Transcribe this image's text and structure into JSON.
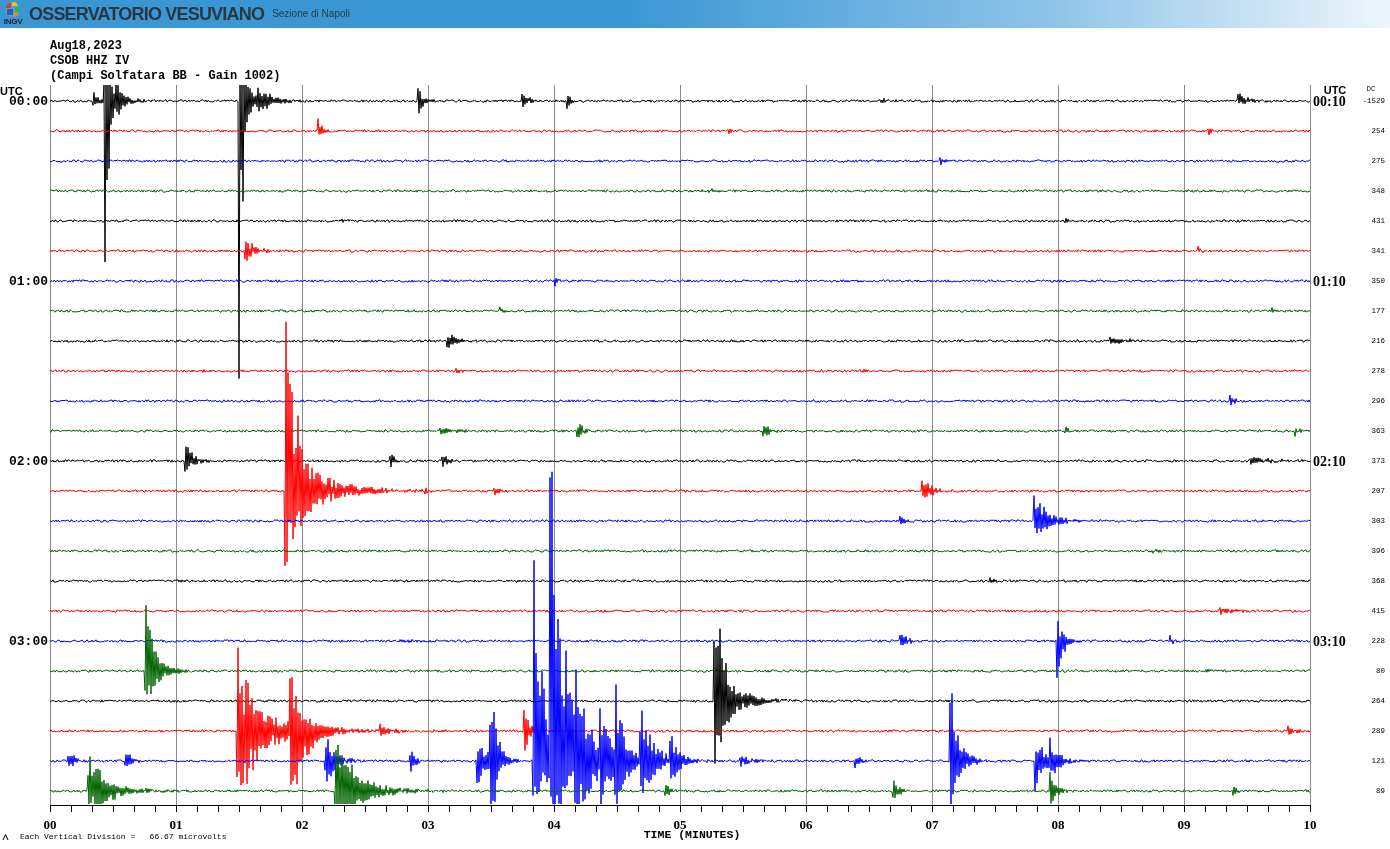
{
  "header": {
    "logo_text": "INGV",
    "title": "OSSERVATORIO VESUVIANO",
    "subtitle": "Sezione di Napoli"
  },
  "info": [
    "Aug18,2023",
    "CSOB HHZ IV",
    "(Campi Solfatara BB - Gain 1002)"
  ],
  "helicorder": {
    "left_heading": "UTC",
    "right_heading": "UTC",
    "dc_heading": "DC",
    "rows": [
      {
        "color": "#000000",
        "dc": "-1529",
        "left_time": "00:00",
        "right_time": "00:10"
      },
      {
        "color": "#ff0000",
        "dc": "254"
      },
      {
        "color": "#0000ff",
        "dc": "275"
      },
      {
        "color": "#006400",
        "dc": "348"
      },
      {
        "color": "#000000",
        "dc": "431"
      },
      {
        "color": "#ff0000",
        "dc": "341"
      },
      {
        "color": "#0000ff",
        "dc": "350",
        "left_time": "01:00",
        "right_time": "01:10"
      },
      {
        "color": "#006400",
        "dc": "177"
      },
      {
        "color": "#000000",
        "dc": "216"
      },
      {
        "color": "#ff0000",
        "dc": "278"
      },
      {
        "color": "#0000ff",
        "dc": "296"
      },
      {
        "color": "#006400",
        "dc": "363"
      },
      {
        "color": "#000000",
        "dc": "373",
        "left_time": "02:00",
        "right_time": "02:10"
      },
      {
        "color": "#ff0000",
        "dc": "207"
      },
      {
        "color": "#0000ff",
        "dc": "303"
      },
      {
        "color": "#006400",
        "dc": "396"
      },
      {
        "color": "#000000",
        "dc": "368"
      },
      {
        "color": "#ff0000",
        "dc": "415"
      },
      {
        "color": "#0000ff",
        "dc": "228",
        "left_time": "03:00",
        "right_time": "03:10"
      },
      {
        "color": "#006400",
        "dc": "80"
      },
      {
        "color": "#000000",
        "dc": "264"
      },
      {
        "color": "#ff0000",
        "dc": "289"
      },
      {
        "color": "#0000ff",
        "dc": "121"
      },
      {
        "color": "#006400",
        "dc": "89"
      }
    ],
    "x_ticks": [
      "00",
      "01",
      "02",
      "03",
      "04",
      "05",
      "06",
      "07",
      "08",
      "09",
      "10"
    ],
    "xlabel": "TIME (MINUTES)",
    "scale_note": "Each Vertical Division =   66.67 microvolts"
  }
}
